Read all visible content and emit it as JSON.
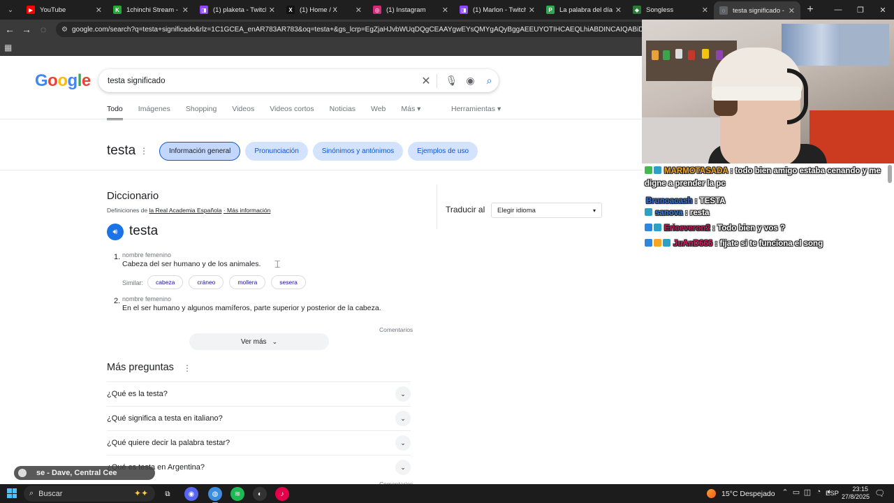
{
  "browser": {
    "tabs": [
      {
        "title": "YouTube",
        "fav_color": "#ff0000",
        "fav_glyph": "▶",
        "active": false
      },
      {
        "title": "1chinchi Stream - Wa",
        "fav_color": "#22aa33",
        "fav_glyph": "K",
        "active": false
      },
      {
        "title": "(1) plaketa - Twitch",
        "fav_color": "#9146ff",
        "fav_glyph": "◨",
        "active": false
      },
      {
        "title": "(1) Home / X",
        "fav_color": "#111111",
        "fav_glyph": "X",
        "active": false
      },
      {
        "title": "(1) Instagram",
        "fav_color": "#d62976",
        "fav_glyph": "◎",
        "active": false
      },
      {
        "title": "(1) Marlon - Twitch",
        "fav_color": "#9146ff",
        "fav_glyph": "◨",
        "active": false
      },
      {
        "title": "La palabra del día",
        "fav_color": "#2fa84f",
        "fav_glyph": "P",
        "active": false
      },
      {
        "title": "Songless",
        "fav_color": "#2a7a3a",
        "fav_glyph": "◆",
        "active": false
      },
      {
        "title": "testa significado - Bu",
        "fav_color": "#5f6368",
        "fav_glyph": "◌",
        "active": true
      }
    ],
    "url": "google.com/search?q=testa+significado&rlz=1C1GCEA_enAR783AR783&oq=testa+&gs_lcrp=EgZjaHJvbWUqDQgCEAAYgwEYsQMYgAQyBggAEEUYOTIHCAEQLhiABDINCAIQABiDARixAxiABDIHCAM"
  },
  "google": {
    "query": "testa significado",
    "tabs": [
      "Todo",
      "Imágenes",
      "Shopping",
      "Videos",
      "Videos cortos",
      "Noticias",
      "Web",
      "Más ▾"
    ],
    "tools": "Herramientas ▾",
    "heading": "testa",
    "chips": [
      "Información general",
      "Pronunciación",
      "Sinónimos y antónimos",
      "Ejemplos de uso"
    ],
    "dictionary": {
      "title": "Diccionario",
      "source_prefix": "Definiciones de",
      "source_link": "la Real Academia Española",
      "more_info": "· Más información",
      "word": "testa",
      "definitions": [
        {
          "num": "1.",
          "pos": "nombre femenino",
          "text": "Cabeza del ser humano y de los animales."
        },
        {
          "num": "2.",
          "pos": "nombre femenino",
          "text": "En el ser humano y algunos mamíferos, parte superior y posterior de la cabeza."
        }
      ],
      "similar_label": "Similar:",
      "similar": [
        "cabeza",
        "cráneo",
        "mollera",
        "sesera"
      ],
      "comments": "Comentarios",
      "see_more": "Ver más"
    },
    "translate": {
      "label": "Traducir al",
      "select": "Elegir idioma"
    },
    "more_questions": {
      "title": "Más preguntas",
      "items": [
        "¿Qué es la testa?",
        "¿Qué significa a testa en italiano?",
        "¿Qué quiere decir la palabra testar?",
        "¿Qué es testa en Argentina?"
      ]
    },
    "partial_comments": "Comentarios"
  },
  "stream": {
    "chat": [
      {
        "user": "MARMOTASADA",
        "user_color": "#f5a623",
        "badges": [
          "#3fb950",
          "#2ea0c4"
        ],
        "text": "todo bien amigo estaba cenando y me digne a prender la pc"
      },
      {
        "user": "Brunoacash",
        "user_color": "#2a6fdb",
        "badges": [],
        "text": "TESTA"
      },
      {
        "user": "sanova",
        "user_color": "#3a7bd5",
        "badges": [
          "#2ea0c4"
        ],
        "text": "resta"
      },
      {
        "user": "Ericeveron2",
        "user_color": "#c2185b",
        "badges": [
          "#2e86de",
          "#2ea0c4"
        ],
        "text": "Todo bien y vos ?"
      },
      {
        "user": "JuAnD666",
        "user_color": "#d81b60",
        "badges": [
          "#2e86de",
          "#f5a623",
          "#2ea0c4"
        ],
        "text": "fijate si te funciona el song"
      }
    ],
    "now_playing": "se - Dave, Central Cee"
  },
  "taskbar": {
    "search": "Buscar",
    "weather": "15°C Despejado",
    "lang": "ESP",
    "time": "23:15",
    "date": "27/8/2025",
    "apps": [
      {
        "name": "taskview-icon",
        "color": "#1c1c1c",
        "glyph": "⧉"
      },
      {
        "name": "discord-like-icon",
        "color": "#5865f2",
        "glyph": "◉"
      },
      {
        "name": "chrome-icon",
        "color": "#3c8dde",
        "glyph": "◍"
      },
      {
        "name": "spotify-icon",
        "color": "#1db954",
        "glyph": "≋"
      },
      {
        "name": "obs-icon",
        "color": "#333333",
        "glyph": "◐"
      },
      {
        "name": "tiktok-icon",
        "color": "#e4004b",
        "glyph": "♪"
      }
    ]
  }
}
